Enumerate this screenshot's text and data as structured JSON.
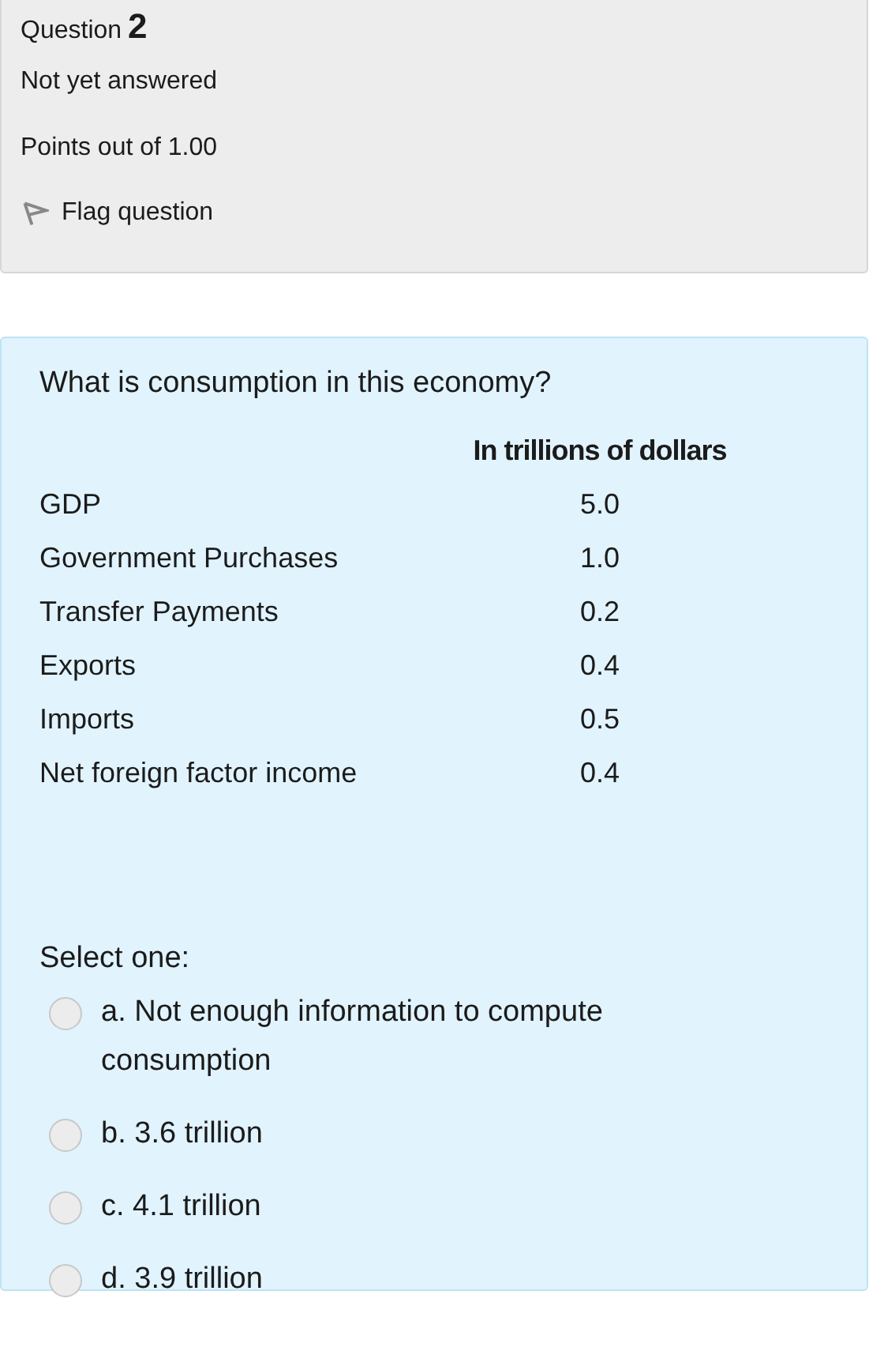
{
  "info": {
    "label": "Question",
    "number": "2",
    "status": "Not yet answered",
    "points": "Points out of 1.00",
    "flag": {
      "label": "Flag question",
      "flagged": false
    }
  },
  "question": {
    "text": "What is consumption in this economy?",
    "table": {
      "columns": [
        "",
        "In trillions of dollars"
      ],
      "rows": [
        [
          "GDP",
          "5.0"
        ],
        [
          "Government Purchases",
          "1.0"
        ],
        [
          "Transfer Payments",
          "0.2"
        ],
        [
          "Exports",
          "0.4"
        ],
        [
          "Imports",
          "0.5"
        ],
        [
          "Net foreign factor income",
          "0.4"
        ]
      ]
    },
    "prompt": "Select one:",
    "options": [
      {
        "label": "a. Not enough information to compute consumption",
        "selected": false
      },
      {
        "label": "b. 3.6 trillion",
        "selected": false
      },
      {
        "label": "c. 4.1 trillion",
        "selected": false
      },
      {
        "label": "d. 3.9 trillion",
        "selected": false
      }
    ]
  }
}
